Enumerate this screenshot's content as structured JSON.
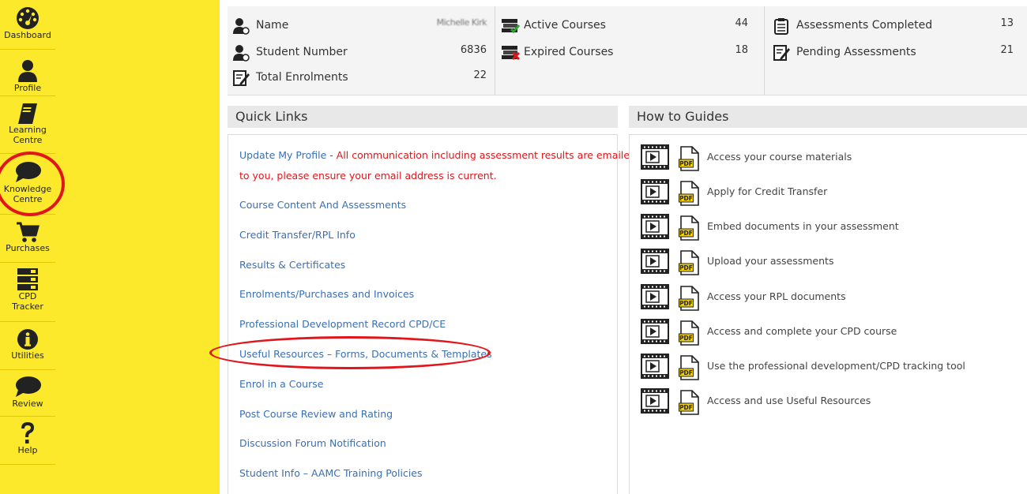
{
  "nav": {
    "items": [
      {
        "label": "Dashboard",
        "icon": "dashboard-icon"
      },
      {
        "label": "Profile",
        "icon": "user-icon"
      },
      {
        "label": "Learning Centre",
        "label1": "Learning",
        "label2": "Centre",
        "icon": "book-icon"
      },
      {
        "label": "Knowledge Centre",
        "label1": "Knowledge",
        "label2": "Centre",
        "icon": "speech-bubble-icon"
      },
      {
        "label": "Purchases",
        "icon": "cart-icon"
      },
      {
        "label": "CPD Tracker",
        "label1": "CPD",
        "label2": "Tracker",
        "icon": "tracker-icon"
      },
      {
        "label": "Utilities",
        "icon": "info-icon"
      },
      {
        "label": "Review",
        "icon": "speech-bubble-icon"
      },
      {
        "label": "Help",
        "icon": "question-icon"
      }
    ]
  },
  "stats": {
    "name_label": "Name",
    "name_value": "Michelle Kirk",
    "student_number_label": "Student Number",
    "student_number_value": "6836",
    "total_enrolments_label": "Total Enrolments",
    "total_enrolments_value": "22",
    "active_courses_label": "Active Courses",
    "active_courses_value": "44",
    "expired_courses_label": "Expired Courses",
    "expired_courses_value": "18",
    "assessments_completed_label": "Assessments Completed",
    "assessments_completed_value": "13",
    "pending_assessments_label": "Pending Assessments",
    "pending_assessments_value": "21"
  },
  "quick_links": {
    "title": "Quick Links",
    "profile_link": "Update My Profile",
    "profile_note_1": " - All communication including assessment results are emailed",
    "profile_note_2": "to you, please ensure your email address is current.",
    "links": [
      "Course Content And Assessments",
      "Credit Transfer/RPL Info",
      "Results & Certificates",
      "Enrolments/Purchases and Invoices",
      "Professional Development Record CPD/CE",
      "Useful Resources – Forms, Documents & Templates",
      "Enrol in a Course",
      "Post Course Review and Rating",
      "Discussion Forum Notification",
      "Student Info – AAMC Training Policies"
    ]
  },
  "guides": {
    "title": "How to Guides",
    "pdf_badge": "PDF",
    "items": [
      "Access your course materials",
      "Apply for Credit Transfer",
      "Embed documents in your assessment",
      "Upload your assessments",
      "Access your RPL documents",
      "Access and complete your CPD course",
      "Use the professional development/CPD tracking tool",
      "Access and use Useful Resources"
    ]
  },
  "colors": {
    "sidebar": "#fde92c",
    "link": "#3a6fb3",
    "alert": "#e0161b",
    "highlight_ring": "#e0161b"
  }
}
